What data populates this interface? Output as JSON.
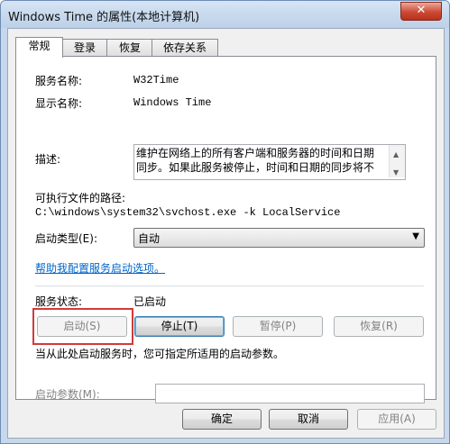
{
  "window": {
    "title": "Windows Time 的属性(本地计算机)",
    "close_glyph": "✕"
  },
  "tabs": [
    {
      "label": "常规"
    },
    {
      "label": "登录"
    },
    {
      "label": "恢复"
    },
    {
      "label": "依存关系"
    }
  ],
  "general": {
    "service_name_label": "服务名称:",
    "service_name_value": "W32Time",
    "display_name_label": "显示名称:",
    "display_name_value": "Windows Time",
    "description_label": "描述:",
    "description_line1": "维护在网络上的所有客户端和服务器的时间和日期",
    "description_line2": "同步。如果此服务被停止，时间和日期的同步将不",
    "exe_path_label": "可执行文件的路径:",
    "exe_path_value": "C:\\windows\\system32\\svchost.exe -k LocalService",
    "startup_type_label": "启动类型(E):",
    "startup_type_value": "自动",
    "help_link": "帮助我配置服务启动选项。",
    "status_label": "服务状态:",
    "status_value": "已启动",
    "start_button": "启动(S)",
    "stop_button": "停止(T)",
    "pause_button": "暂停(P)",
    "resume_button": "恢复(R)",
    "hint_text": "当从此处启动服务时，您可指定所适用的启动参数。",
    "start_params_label": "启动参数(M):",
    "start_params_value": ""
  },
  "footer": {
    "ok_button": "确定",
    "cancel_button": "取消",
    "apply_button": "应用(A)"
  },
  "icons": {
    "scroll_up": "▲",
    "scroll_down": "▼",
    "dropdown": "▼"
  },
  "colors": {
    "highlight_box": "#d23a3a",
    "link": "#0066cc"
  }
}
